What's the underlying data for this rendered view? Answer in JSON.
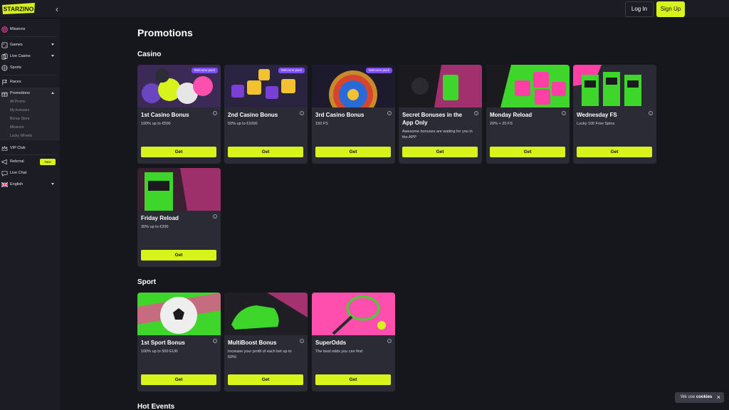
{
  "brand": {
    "logo_text": "STARZINO",
    "accent": "#d8f31c",
    "badge_color": "#7b4dff"
  },
  "header": {
    "login_label": "Log In",
    "signup_label": "Sign Up"
  },
  "sidebar": {
    "items": [
      {
        "label": "Missions",
        "icon": "target-icon"
      },
      {
        "label": "Games",
        "icon": "dice-icon"
      },
      {
        "label": "Live Casino",
        "icon": "cards-icon"
      },
      {
        "label": "Sports",
        "icon": "ball-icon"
      },
      {
        "label": "Races",
        "icon": "flag-icon"
      },
      {
        "label": "Promotions",
        "icon": "gift-icon"
      },
      {
        "label": "VIP Club",
        "icon": "crown-icon"
      },
      {
        "label": "Referral",
        "icon": "megaphone-icon",
        "badge": "New"
      },
      {
        "label": "Live Chat",
        "icon": "chat-icon"
      },
      {
        "label": "English",
        "icon": "flag-uk-icon"
      }
    ],
    "promotions_sub": [
      "All Promo",
      "My bonuses",
      "Bonus Store",
      "Missions",
      "Lucky Wheels"
    ]
  },
  "main": {
    "title": "Promotions",
    "sections": {
      "casino": "Casino",
      "sport": "Sport",
      "hot": "Hot Events"
    },
    "casino_cards": [
      {
        "title": "1st Casino Bonus",
        "desc": "100% up to €500",
        "badge": "Welcome pack",
        "button": "Get"
      },
      {
        "title": "2nd Casino Bonus",
        "desc": "50% up to €1000",
        "badge": "Welcome pack",
        "button": "Get"
      },
      {
        "title": "3rd Casino Bonus",
        "desc": "150 FS",
        "badge": "Welcome pack",
        "button": "Get"
      },
      {
        "title": "Secret Bonuses in the App Only",
        "desc": "Awesome bonuses are waiting for you in the APP",
        "button": "Get"
      },
      {
        "title": "Monday Reload",
        "desc": "20% + 20 FS",
        "button": "Get"
      },
      {
        "title": "Wednesday FS",
        "desc": "Lucky 100 Free Spins",
        "button": "Get"
      },
      {
        "title": "Friday Reload",
        "desc": "30% up to €200",
        "button": "Get"
      }
    ],
    "sport_cards": [
      {
        "title": "1st Sport Bonus",
        "desc": "100% up to 500 EUR",
        "button": "Get"
      },
      {
        "title": "MultiBoost Bonus",
        "desc": "Increase your profit of each bet up to 50%!",
        "button": "Get"
      },
      {
        "title": "SuperOdds",
        "desc": "The best odds you can find",
        "button": "Get"
      }
    ]
  },
  "cookie": {
    "text": "We use",
    "link": "cookies"
  }
}
